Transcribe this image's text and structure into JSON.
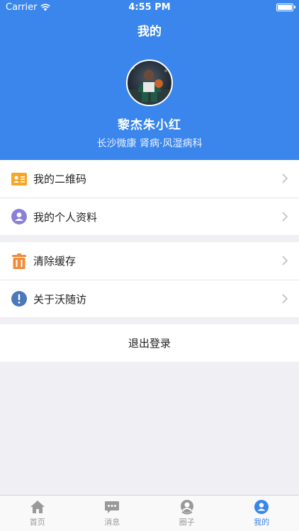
{
  "status_bar": {
    "carrier": "Carrier",
    "time": "4:55 PM"
  },
  "header": {
    "title": "我的",
    "user_name": "黎杰朱小红",
    "user_org": "长沙微康 肾病·风湿病科"
  },
  "menu_group_1": [
    {
      "label": "我的二维码",
      "icon": "qrcode-card-icon"
    },
    {
      "label": "我的个人资料",
      "icon": "profile-icon"
    }
  ],
  "menu_group_2": [
    {
      "label": "清除缓存",
      "icon": "trash-icon"
    },
    {
      "label": "关于沃随访",
      "icon": "info-icon"
    }
  ],
  "logout": {
    "label": "退出登录"
  },
  "tabbar": {
    "tabs": [
      {
        "label": "首页",
        "icon": "home-icon"
      },
      {
        "label": "消息",
        "icon": "message-icon"
      },
      {
        "label": "圈子",
        "icon": "circle-icon"
      },
      {
        "label": "我的",
        "icon": "me-icon"
      }
    ],
    "active_index": 3
  },
  "colors": {
    "accent": "#3a86ec",
    "inactive": "#999999"
  }
}
